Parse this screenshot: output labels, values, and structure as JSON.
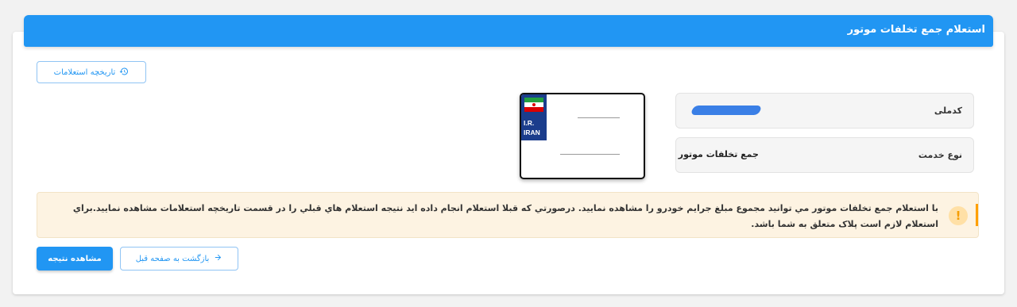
{
  "header": {
    "title": "استعلام جمع تخلفات موتور"
  },
  "toolbar": {
    "history_label": "تاريخچه استعلامات"
  },
  "form": {
    "national_code": {
      "label": "کدملی",
      "value": ""
    },
    "service_type": {
      "label": "نوع خدمت",
      "value": "جمع تخلفات موتور"
    }
  },
  "plate": {
    "country_line1": "I.R.",
    "country_line2": "IRAN"
  },
  "alert": {
    "text": "با استعلام جمع تخلفات موتور مي توانيد مجموع مبلغ جرايم خودرو را مشاهده نماييد. درصورتي که قبلا استعلام انجام داده ايد نتيجه استعلام هاي قبلي را در قسمت تاريخچه استعلامات مشاهده نماييد.براي استعلام لازم است پلاک متعلق به شما باشد."
  },
  "actions": {
    "view_result_label": "مشاهده نتيجه",
    "back_label": "بازگشت به صفحه قبل"
  },
  "icons": {
    "history": "history-icon",
    "back": "arrow-right-icon",
    "warning": "exclamation-icon"
  },
  "colors": {
    "primary": "#2196f3",
    "warning": "#ffa000",
    "alert_bg": "#fdf3e2"
  }
}
